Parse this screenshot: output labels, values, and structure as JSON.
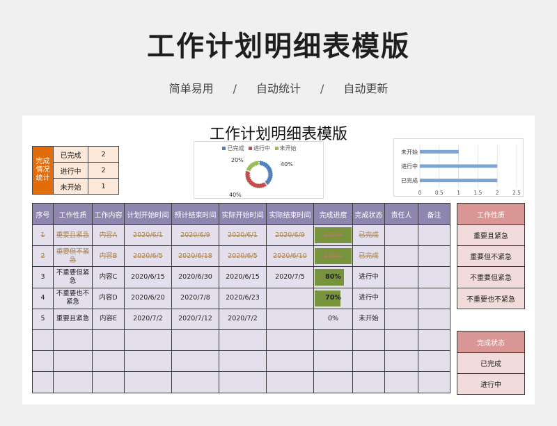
{
  "banner": {
    "title": "工作计划明细表模版",
    "tags": [
      "简单易用",
      "/",
      "自动统计",
      "/",
      "自动更新"
    ]
  },
  "sheet": {
    "title": "工作计划明细表模版"
  },
  "summary": {
    "header": "完成情况统计",
    "rows": [
      {
        "label": "已完成",
        "value": "2"
      },
      {
        "label": "进行中",
        "value": "2"
      },
      {
        "label": "未开始",
        "value": "1"
      }
    ]
  },
  "donut_chart": {
    "legend": [
      "已完成",
      "进行中",
      "未开始"
    ],
    "labels": [
      "40%",
      "40%",
      "20%"
    ],
    "colors": [
      "#4f81bd",
      "#c0504d",
      "#9bbb59"
    ]
  },
  "chart_data": {
    "type": "bar",
    "categories": [
      "未开始",
      "进行中",
      "已完成"
    ],
    "values": [
      1,
      2,
      2
    ],
    "xlim": [
      0,
      2.5
    ],
    "xticks": [
      "0",
      "0.5",
      "1",
      "1.5",
      "2",
      "2.5"
    ],
    "grid": true,
    "color": "#7ba3d3"
  },
  "table": {
    "headers": [
      "序号",
      "工作性质",
      "工作内容",
      "计划开始时间",
      "预计结束时间",
      "实际开始时间",
      "实际结束时间",
      "完成进度",
      "完成状态",
      "责任人",
      "备注"
    ],
    "rows": [
      {
        "no": "1",
        "nature": "重要且紧急",
        "content": "内容A",
        "plan_start": "2020/6/1",
        "plan_end": "2020/6/9",
        "act_start": "2020/6/1",
        "act_end": "2020/6/9",
        "progress": "100%",
        "progress_value": 1.0,
        "status": "已完成",
        "owner": "",
        "note": "",
        "done": true
      },
      {
        "no": "2",
        "nature": "重要但不紧急",
        "content": "内容B",
        "plan_start": "2020/6/5",
        "plan_end": "2020/6/18",
        "act_start": "2020/6/5",
        "act_end": "2020/6/10",
        "progress": "100%",
        "progress_value": 1.0,
        "status": "已完成",
        "owner": "",
        "note": "",
        "done": true
      },
      {
        "no": "3",
        "nature": "不重要但紧急",
        "content": "内容C",
        "plan_start": "2020/6/15",
        "plan_end": "2020/6/30",
        "act_start": "2020/6/15",
        "act_end": "2020/7/5",
        "progress": "80%",
        "progress_value": 0.8,
        "status": "进行中",
        "owner": "",
        "note": "",
        "done": false
      },
      {
        "no": "4",
        "nature": "不重要也不紧急",
        "content": "内容D",
        "plan_start": "2020/6/20",
        "plan_end": "2020/7/8",
        "act_start": "2020/6/23",
        "act_end": "",
        "progress": "70%",
        "progress_value": 0.7,
        "status": "进行中",
        "owner": "",
        "note": "",
        "done": false
      },
      {
        "no": "5",
        "nature": "重要且紧急",
        "content": "内容E",
        "plan_start": "2020/7/2",
        "plan_end": "2020/7/12",
        "act_start": "2020/7/2",
        "act_end": "",
        "progress": "0%",
        "progress_value": 0,
        "status": "未开始",
        "owner": "",
        "note": "",
        "done": false
      }
    ],
    "empty_rows": 3
  },
  "nature_list": {
    "header": "工作性质",
    "items": [
      "重要且紧急",
      "重要但不紧急",
      "不重要但紧急",
      "不重要也不紧急"
    ]
  },
  "status_list": {
    "header": "完成状态",
    "items": [
      "已完成",
      "进行中"
    ]
  }
}
